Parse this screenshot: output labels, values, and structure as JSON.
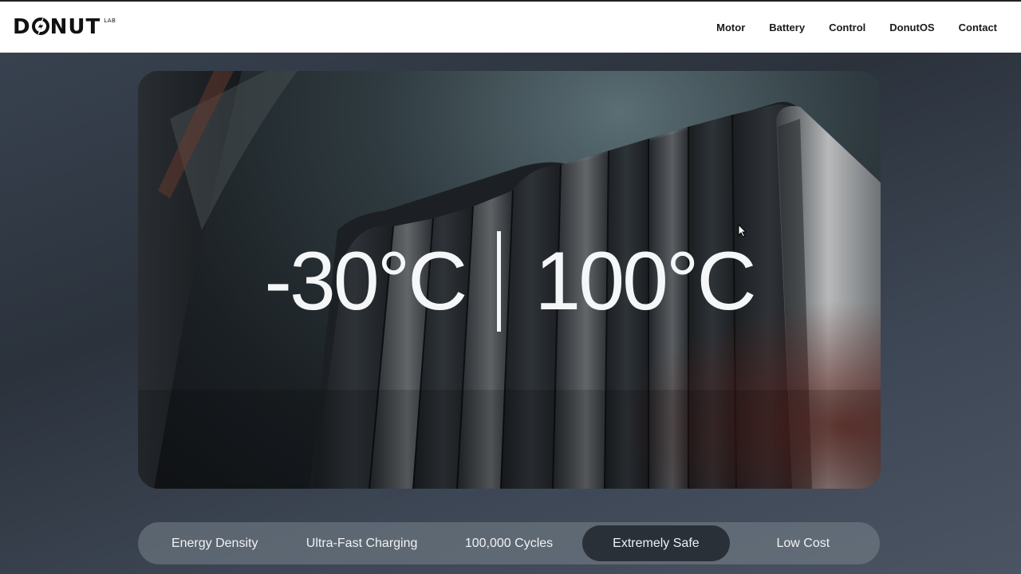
{
  "brand": {
    "name_pre": "D",
    "name_post": "NUT",
    "sub": "LAB"
  },
  "nav": {
    "items": [
      "Motor",
      "Battery",
      "Control",
      "DonutOS",
      "Contact"
    ]
  },
  "hero": {
    "low_temp": "-30°C",
    "high_temp": "100°C"
  },
  "tabs": {
    "items": [
      "Energy Density",
      "Ultra-Fast Charging",
      "100,000 Cycles",
      "Extremely Safe",
      "Low Cost"
    ],
    "active": "Extremely Safe"
  },
  "colors": {
    "nav_bg": "#ffffff",
    "active_tab": "#2a3038",
    "text_light": "#f4f6f7"
  }
}
